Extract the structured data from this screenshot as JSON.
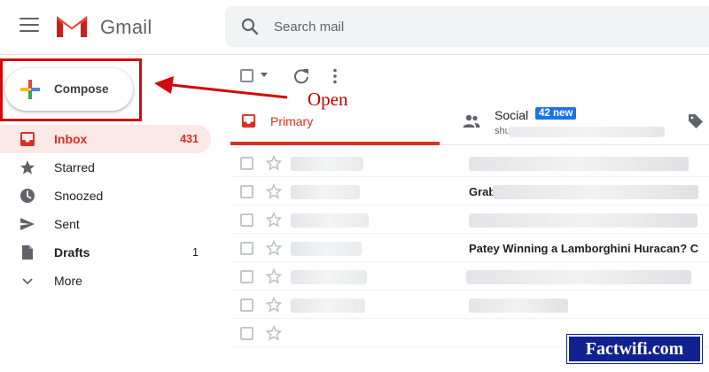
{
  "header": {
    "app_name": "Gmail",
    "search_placeholder": "Search mail"
  },
  "compose": {
    "label": "Compose"
  },
  "annotation": {
    "text": "Open",
    "color": "#c00000"
  },
  "sidebar": {
    "items": [
      {
        "label": "Inbox",
        "count": "431",
        "icon": "inbox-icon",
        "active": true
      },
      {
        "label": "Starred",
        "count": "",
        "icon": "star-icon"
      },
      {
        "label": "Snoozed",
        "count": "",
        "icon": "clock-icon"
      },
      {
        "label": "Sent",
        "count": "",
        "icon": "send-icon"
      },
      {
        "label": "Drafts",
        "count": "1",
        "icon": "draft-icon"
      },
      {
        "label": "More",
        "count": "",
        "icon": "chevron-down-icon"
      }
    ]
  },
  "tabs": {
    "primary": {
      "label": "Primary"
    },
    "social": {
      "label": "Social",
      "badge": "42 new",
      "sender_prefix": "shu"
    }
  },
  "emails": [
    {
      "subject_visible": ""
    },
    {
      "subject_visible": "Grab"
    },
    {
      "subject_visible": ""
    },
    {
      "subject_visible": "Patey Winning a Lamborghini Huracan? C"
    },
    {
      "subject_visible": ""
    },
    {
      "subject_visible": ""
    },
    {
      "subject_visible": ""
    }
  ],
  "colors": {
    "accent_red": "#d93025",
    "badge_blue": "#1a73e8",
    "highlight_box": "#d10a0a",
    "watermark_bg": "#10228f"
  },
  "watermark": {
    "text": "Factwifi.com"
  }
}
